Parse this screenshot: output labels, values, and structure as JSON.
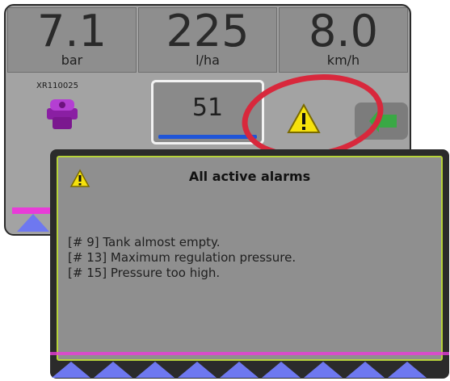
{
  "top_metrics": [
    {
      "value": "7.1",
      "unit": "bar"
    },
    {
      "value": "225",
      "unit": "l/ha"
    },
    {
      "value": "8.0",
      "unit": "km/h"
    }
  ],
  "nozzle": {
    "label": "XR110025"
  },
  "selected_value": "51",
  "obscured_row": [
    "7.1",
    "225",
    "8.0"
  ],
  "dialog": {
    "title": "All active alarms",
    "alarms": [
      "[#  9] Tank almost empty.",
      "[# 13] Maximum regulation pressure.",
      "[# 15] Pressure too high."
    ]
  },
  "icons": {
    "warning": "warning-triangle-icon",
    "nozzle": "nozzle-icon",
    "arrow": "arrow-left-icon"
  },
  "colors": {
    "dialog_border": "#b7d33a",
    "highlight_ellipse": "#d8283c",
    "progress_bar": "#1f55d8",
    "warning_yellow": "#f6e20c"
  }
}
